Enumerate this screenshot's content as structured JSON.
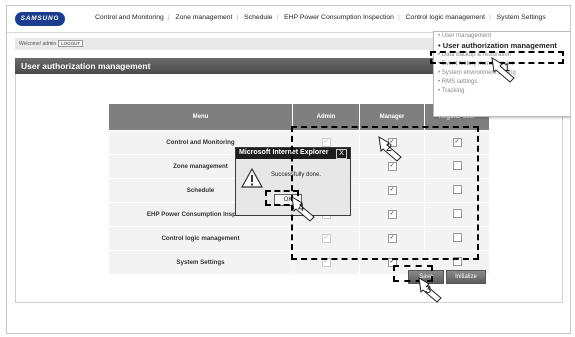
{
  "app": {
    "logo": "SAMSUNG",
    "nav": [
      "Control and Monitoring",
      "Zone management",
      "Schedule",
      "EHP Power Consumption Inspection",
      "Control logic management",
      "System Settings"
    ],
    "welcome": "Welcome! admin",
    "logout_label": "LOGOUT"
  },
  "page": {
    "title": "User authorization management"
  },
  "dropdown": {
    "items": [
      {
        "label": "• User management",
        "active": false
      },
      {
        "label": "• User authorization management",
        "active": true
      },
      {
        "label": "• Data backup & restoration",
        "active": false
      },
      {
        "label": "• Event history management",
        "active": false
      },
      {
        "label": "• System environment setting",
        "active": false
      },
      {
        "label": "• RMS settings",
        "active": false
      },
      {
        "label": "• Tracking",
        "active": false
      }
    ]
  },
  "table": {
    "headers": [
      "Menu",
      "Admin",
      "Manager",
      "Regular user"
    ],
    "rows": [
      {
        "menu": "Control and Monitoring",
        "admin": true,
        "manager": true,
        "regular": true
      },
      {
        "menu": "Zone management",
        "admin": true,
        "manager": true,
        "regular": false
      },
      {
        "menu": "Schedule",
        "admin": true,
        "manager": true,
        "regular": false
      },
      {
        "menu": "EHP Power Consumption Inspection",
        "admin": true,
        "manager": true,
        "regular": false
      },
      {
        "menu": "Control logic management",
        "admin": true,
        "manager": true,
        "regular": false
      },
      {
        "menu": "System Settings",
        "admin": true,
        "manager": true,
        "regular": false
      }
    ]
  },
  "buttons": {
    "save": "Save",
    "initialize": "Initialize"
  },
  "dialog": {
    "title": "Microsoft Internet Explorer",
    "message": "Successfully done.",
    "ok_label": "OK",
    "close_glyph": "X"
  },
  "callouts": [
    "1",
    "2",
    "3",
    "4"
  ]
}
